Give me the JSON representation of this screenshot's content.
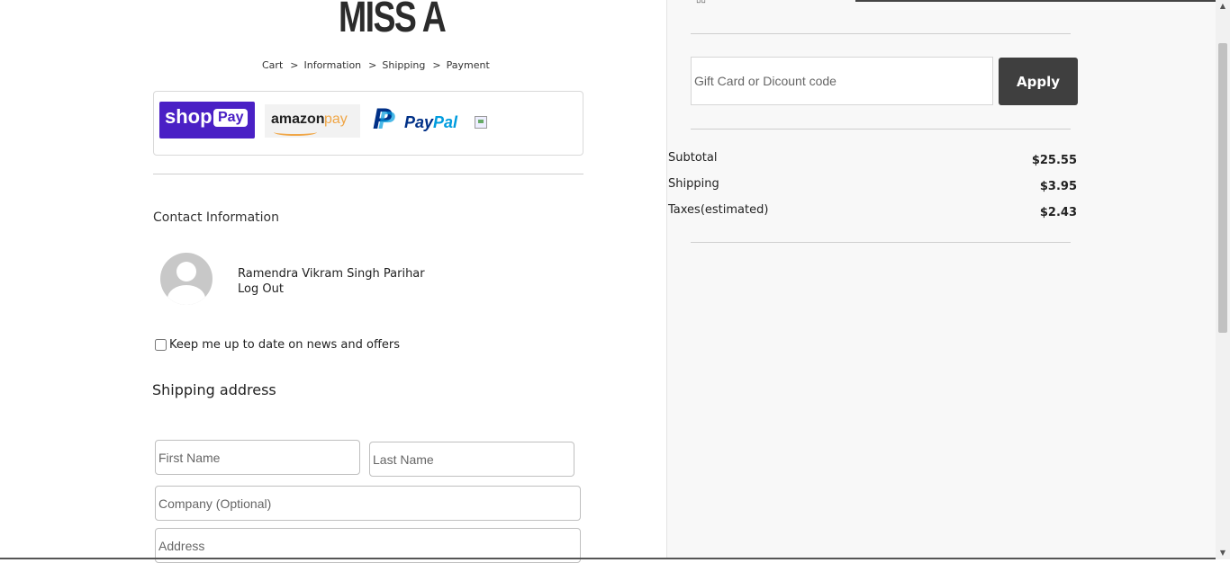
{
  "brand": {
    "logo_text": "MISS A"
  },
  "breadcrumb": {
    "items": [
      "Cart",
      "Information",
      "Shipping",
      "Payment"
    ],
    "separator": ">"
  },
  "express_checkout": {
    "shop_pay": {
      "label_shop": "shop",
      "label_pay": "Pay"
    },
    "amazon_pay": {
      "label_amazon": "amazon",
      "label_pay": "pay"
    },
    "paypal": {
      "label_pay": "Pay",
      "label_pal": "Pal"
    }
  },
  "contact": {
    "heading": "Contact Information",
    "user_name": "Ramendra Vikram Singh Parihar",
    "logout_label": "Log Out",
    "newsletter_label": "Keep me up to date on news and offers",
    "newsletter_checked": false
  },
  "shipping": {
    "heading": "Shipping address",
    "first_name_placeholder": "First Name",
    "last_name_placeholder": "Last Name",
    "company_placeholder": "Company (Optional)",
    "address_placeholder": "Address"
  },
  "discount": {
    "placeholder": "Gift Card or Dicount code",
    "apply_label": "Apply"
  },
  "summary": {
    "rows": [
      {
        "label": "Subtotal",
        "value": "$25.55"
      },
      {
        "label": "Shipping",
        "value": "$3.95"
      },
      {
        "label": "Taxes(estimated)",
        "value": "$2.43"
      }
    ]
  },
  "colors": {
    "apply_button": "#3f3f3f",
    "shop_pay_bg": "#4a20c5",
    "paypal_dark": "#003087",
    "paypal_light": "#009cde",
    "amazon_orange": "#f0a646",
    "right_panel_bg": "#f8f8f8"
  }
}
